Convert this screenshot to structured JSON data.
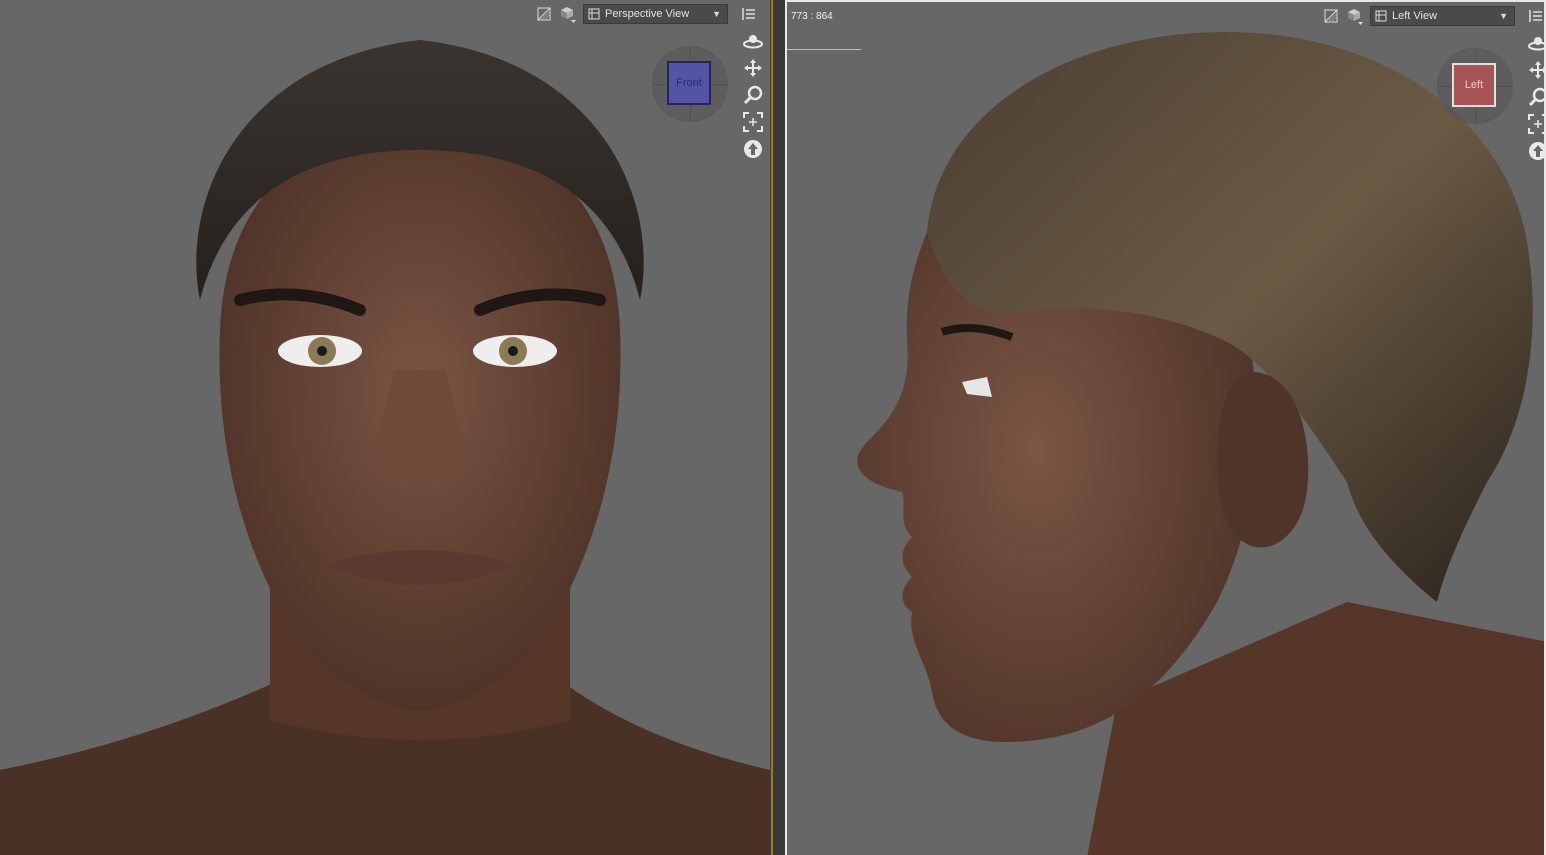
{
  "left_viewport": {
    "view_label": "Perspective View",
    "cube_face": "Front",
    "cube_color": "#5454a6",
    "icons": [
      "display-style-icon",
      "shading-cube-icon",
      "viewport-menu-icon"
    ],
    "nav_tools": [
      "orbit-icon",
      "pan-icon",
      "zoom-icon",
      "frame-icon",
      "reset-view-icon"
    ]
  },
  "right_viewport": {
    "view_label": "Left View",
    "cube_face": "Left",
    "cube_color": "#a85454",
    "coordinates": "773 : 864",
    "icons": [
      "display-style-icon",
      "shading-cube-icon",
      "viewport-menu-icon"
    ],
    "nav_tools": [
      "orbit-icon",
      "pan-icon",
      "zoom-icon",
      "frame-icon",
      "reset-view-icon"
    ]
  },
  "colors": {
    "viewport_bg": "#676767",
    "active_border": "#e8e8e8",
    "divider_accent": "#a07a1e"
  }
}
